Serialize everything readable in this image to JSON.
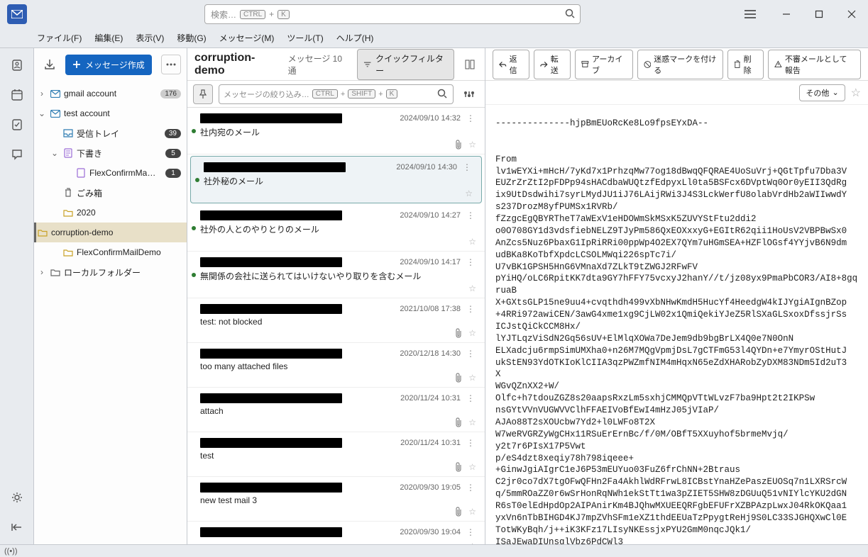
{
  "search": {
    "placeholder_text": "検索…",
    "kbd1": "CTRL",
    "kbd_plus": "+",
    "kbd2": "K"
  },
  "menubar": [
    "ファイル(F)",
    "編集(E)",
    "表示(V)",
    "移動(G)",
    "メッセージ(M)",
    "ツール(T)",
    "ヘルプ(H)"
  ],
  "compose_label": "メッセージ作成",
  "accounts": [
    {
      "name": "gmail account",
      "badge": "176",
      "expanded": false
    },
    {
      "name": "test account",
      "expanded": true
    }
  ],
  "folders": {
    "inbox": {
      "label": "受信トレイ",
      "badge": "39"
    },
    "drafts": {
      "label": "下書き",
      "badge": "5",
      "expanded": true
    },
    "flexconfirm": {
      "label": "FlexConfirmMa…",
      "badge": "1"
    },
    "trash": {
      "label": "ごみ箱"
    },
    "f2020": {
      "label": "2020"
    },
    "corruption": {
      "label": "corruption-demo"
    },
    "flexdemo": {
      "label": "FlexConfirmMailDemo"
    },
    "local": {
      "label": "ローカルフォルダー"
    }
  },
  "list_header": {
    "title": "corruption-demo",
    "count_label": "メッセージ 10 通",
    "quick_filter": "クイックフィルター"
  },
  "filter": {
    "placeholder": "メッセージの絞り込み…",
    "kbd1": "CTRL",
    "kbd2": "SHIFT",
    "kbd3": "K",
    "plus": "+"
  },
  "messages": [
    {
      "from_w": 200,
      "date": "2024/09/10 14:32",
      "subject": "社内宛のメール",
      "unread": true,
      "attach": true
    },
    {
      "from_w": 200,
      "date": "2024/09/10 14:30",
      "subject": "社外秘のメール",
      "unread": true,
      "selected": true
    },
    {
      "from_w": 200,
      "date": "2024/09/10 14:27",
      "subject": "社外の人とのやりとりのメール",
      "unread": true
    },
    {
      "from_w": 200,
      "date": "2024/09/10 14:17",
      "subject": "無関係の会社に送られてはいけないやり取りを含むメール",
      "unread": true
    },
    {
      "from_w": 200,
      "date": "2021/10/08 17:38",
      "subject": "test: not blocked",
      "attach": true
    },
    {
      "from_w": 200,
      "date": "2020/12/18 14:30",
      "subject": "too many attached files",
      "attach": true
    },
    {
      "from_w": 200,
      "date": "2020/11/24 10:31",
      "subject": "attach",
      "attach": true
    },
    {
      "from_w": 200,
      "date": "2020/11/24 10:31",
      "subject": "test",
      "attach": true
    },
    {
      "from_w": 200,
      "date": "2020/09/30 19:05",
      "subject": "new test mail 3",
      "attach": true
    },
    {
      "from_w": 200,
      "date": "2020/09/30 19:04",
      "subject": ""
    }
  ],
  "reading_actions": {
    "reply": "返信",
    "forward": "転送",
    "archive": "アーカイブ",
    "junk": "迷惑マークを付ける",
    "delete": "削除",
    "report": "不審メールとして報告",
    "other": "その他"
  },
  "body": "--------------hjpBmEUoRcKe8Lo9fpsEYxDA--\n\n\nFrom\nlv1wEYXi+mHcH/7yKd7x1PrhzqMw77og18dBwqQFQRAE4UoSuVrj+QGtTpfu7Dba3V\nEUZrZrZtI2pFDPp94sHACdbaWUQtzfEdpyxLl0ta5BSFcx6DVptWq0Or0yEII3QdRg\nix9UtDsdwihi7syrLMydJU1iJ76LAijRWi3J4S3LckWerfU8olabVrdHb2aWIIwwdY\ns237DrozM8yfPUMSx1RVRb/\nfZzgcEgQBYRTheT7aWExV1eHDOWmSkMSxK5ZUVYStFtu2ddi2\no0O708GY1d3vdsfiebNELZ9TJyPm586QxEOXxxyG+EGItR62qii1HoUsV2VBPBwSx0\nAnZcs5Nuz6PbaxG1IpRiRRi00ppWp4O2EX7QYm7uHGmSEA+HZFlOGsf4YYjvB6N9dm\nudBKa8KoTbfXpdcLCSOLMWqi226spTc7i/\nU7vBK1GPSH5HnG6VMnaXd7ZLkT9tZWGJ2RFwFV\npYiHQ/oLC6RpitKK7dta9GY7hFFY75vcxyJ2hanY//t/jz08yx9PmaPbCOR3/AI8+8gqruaB\nX+GXtsGLP15ne9uu4+cvqthdh499vXbNHwKmdH5HucYf4HeedgW4kIJYgiAIgnBZop\n+4RRi972awiCEN/3awG4xme1xg9CjLW02x1QmiQekiYJeZ5RlSXaGLSxoxDfssjrSs\nICJstQiCkCCM8Hx/\nlYJTLqzViSdN2Gq56sUV+ElMlqXOWa7DeJem9db9bgBrLX4Q0e7N0OnN\nELXadcju6rmpSimUMXha0+n26M7MQgVpmjDsL7gCTFmG53l4QYDn+e7YmyrOStHutJ\nukStEN93YdOTKIoKlCIIA3qzPWZmfNIM4mHqxN65eZdXHARobZyDXM83NDm5Id2uT3\nX\nWGvQZnXX2+W/\nOlfc+h7tdouZGZ8s20aapsRxzLm5sxhjCMMQpVTtWLvzF7ba9Hpt2t2IKPSw\nnsGYtVVnVUGWVVClhFFAEIVoBfEwI4mHzJ05jVIaP/\nAJAo88T2sXOUcbw7Yd2+l0LWFo8T2X\nW7weRVGRZyWgCHx11RSuErErnBc/f/0M/OBfT5XXuyhof5brmeMvjq/\ny2t7r6PIsX17P5Vwt\np/eS4dzt8xeqiy78h798iqeee+\n+GinwJgiAIgrC1eJ6P53mEUYuo03FuZ6frChNN+2Btraus\nC2jr0co7dX7tgOFwQFHn2Fa4AkhlWdRFrwL8ICBstYnaHZePaszEUOSq7n1LXRSrcW\nq/5mmROaZZ0r6wSrHonRqNWh1ekStTt1wa3pZIET5SHW8zDGUuQ51vNIYlcYKU2dGN\nR6sT0elEdHpdOp2AIPAnirKm4BJQhwMXUEEQRFgbEFUFrXZBPAzpLwxJ04RkOKQaa1\nyxVn6nTbBIHGD4KJ7mpZVhSFm1eXZ1thdEEUaTzPpygtReHj9S0LC33SJGHQXwCl0E\nTotWKyBqh/j++iK3KFz17LIsyNKEssjxPYU2GmM0nqcJQk1/\nISaJEwaDIUnsqlVbz6PdCWl3\n"
}
